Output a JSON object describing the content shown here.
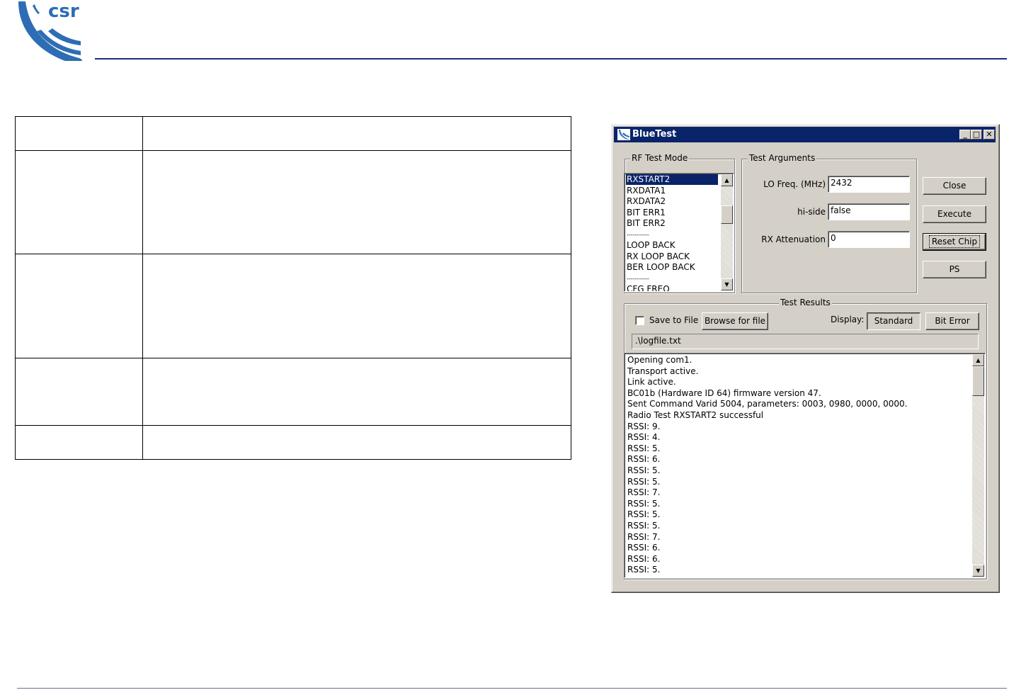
{
  "header": {
    "logo_text": "csr"
  },
  "window": {
    "title": "BlueTest",
    "minimize_label": "_",
    "maximize_label": "□",
    "close_label": "✕",
    "icon": "bluetest-app-icon"
  },
  "rf_test_mode": {
    "label": "RF Test Mode",
    "items": [
      "RXSTART2",
      "RXDATA1",
      "RXDATA2",
      "BIT ERR1",
      "BIT ERR2",
      "-----------",
      "LOOP BACK",
      "RX LOOP BACK",
      "BER LOOP BACK",
      "-----------",
      "CFG FREQ"
    ],
    "selected": "RXSTART2"
  },
  "test_arguments": {
    "label": "Test Arguments",
    "lo_freq_label": "LO Freq. (MHz)",
    "lo_freq_value": "2432",
    "hiside_label": "hi-side",
    "hiside_value": "false",
    "rx_atten_label": "RX Attenuation",
    "rx_atten_value": "0"
  },
  "buttons": {
    "close": "Close",
    "execute": "Execute",
    "reset_chip": "Reset Chip",
    "ps": "PS"
  },
  "test_results": {
    "label": "Test Results",
    "save_to_file": "Save to File",
    "save_checked": false,
    "browse": "Browse for file",
    "display_label": "Display:",
    "standard": "Standard",
    "bit_error": "Bit Error",
    "file_path": ".\\logfile.txt",
    "log": [
      "Opening com1.",
      "Transport active.",
      "Link active.",
      "BC01b (Hardware ID 64) firmware version 47.",
      "Sent Command Varid 5004, parameters: 0003, 0980, 0000, 0000.",
      "Radio Test RXSTART2 successful",
      "RSSI: 9.",
      "RSSI: 4.",
      "RSSI: 5.",
      "RSSI: 6.",
      "RSSI: 5.",
      "RSSI: 5.",
      "RSSI: 7.",
      "RSSI: 5.",
      "RSSI: 5.",
      "RSSI: 5.",
      "RSSI: 7.",
      "RSSI: 6.",
      "RSSI: 6.",
      "RSSI: 5."
    ]
  }
}
